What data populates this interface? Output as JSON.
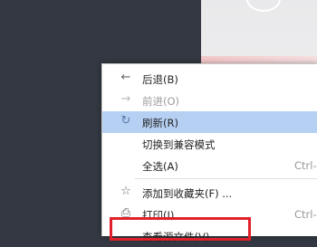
{
  "menu": {
    "items": [
      {
        "label": "后退(B)",
        "icon": "arrow-left-icon",
        "glyph": "←"
      },
      {
        "label": "前进(O)",
        "icon": "arrow-right-icon",
        "glyph": "→"
      },
      {
        "label": "刷新(R)",
        "icon": "refresh-icon",
        "glyph": "↻"
      },
      {
        "label": "切换到兼容模式"
      },
      {
        "label": "全选(A)",
        "shortcut": "Ctrl-"
      },
      {
        "label": "添加到收藏夹(F) ...",
        "icon": "star-icon",
        "glyph": "☆"
      },
      {
        "label": "打印(I) ...",
        "icon": "print-icon",
        "glyph": "⎙",
        "shortcut": "Ctrl-"
      },
      {
        "label": "查看源文件(V)"
      }
    ]
  },
  "colors": {
    "highlight": "#b6d0f3",
    "highlight_box": "#e0202a"
  }
}
